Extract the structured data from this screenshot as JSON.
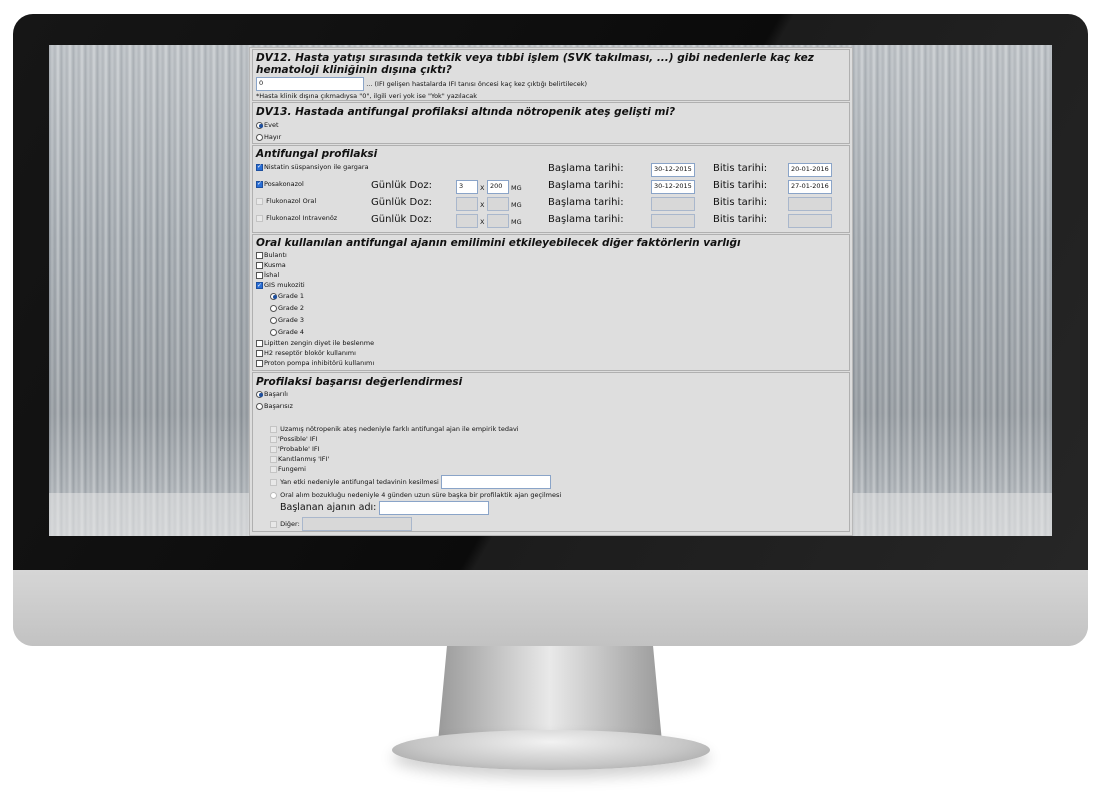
{
  "dv12": {
    "question": "DV12. Hasta yatışı sırasında tetkik veya tıbbi işlem (SVK takılması, ...) gibi nedenlerle kaç kez hematoloji kliniğinin dışına çıktı?",
    "value": "0",
    "hint": "... (IFI gelişen hastalarda IFI tanısı öncesi kaç kez çıktığı belirtilecek)",
    "note": "*Hasta klinik dışına çıkmadıysa \"0\", ilgili veri yok ise \"Yok\" yazılacak"
  },
  "dv13": {
    "question": "DV13. Hastada antifungal profilaksi altında nötropenik ateş gelişti mi?",
    "options": [
      {
        "label": "Evet",
        "selected": true
      },
      {
        "label": "Hayır",
        "selected": false
      }
    ]
  },
  "antifungal": {
    "title": "Antifungal profilaksi",
    "dose_label": "Günlük Doz:",
    "x_label": "X",
    "mg_label": "MG",
    "start_label": "Başlama tarihi:",
    "end_label": "Bitis tarihi:",
    "rows": [
      {
        "name": "Nistatin süspansiyon ile gargara",
        "checked": true,
        "has_dose": false,
        "dose1": "",
        "dose2": "",
        "start": "30-12-2015",
        "end": "20-01-2016"
      },
      {
        "name": "Posakonazol",
        "checked": true,
        "has_dose": true,
        "dose1": "3",
        "dose2": "200",
        "start": "30-12-2015",
        "end": "27-01-2016"
      },
      {
        "name": "Flukonazol Oral",
        "checked": false,
        "has_dose": true,
        "dose1": "",
        "dose2": "",
        "start": "",
        "end": ""
      },
      {
        "name": "Flukonazol Intravenöz",
        "checked": false,
        "has_dose": true,
        "dose1": "",
        "dose2": "",
        "start": "",
        "end": ""
      }
    ]
  },
  "oral": {
    "title": "Oral kullanılan antifungal ajanın emilimini etkileyebilecek diğer faktörlerin varlığı",
    "items": [
      {
        "label": "Bulantı",
        "checked": false
      },
      {
        "label": "Kusma",
        "checked": false
      },
      {
        "label": "İshal",
        "checked": false
      },
      {
        "label": "GIS mukoziti",
        "checked": true
      }
    ],
    "grades": [
      {
        "label": "Grade 1",
        "selected": true
      },
      {
        "label": "Grade 2",
        "selected": false
      },
      {
        "label": "Grade 3",
        "selected": false
      },
      {
        "label": "Grade 4",
        "selected": false
      }
    ],
    "items2": [
      {
        "label": "Lipitten zengin diyet ile beslenme",
        "checked": false
      },
      {
        "label": "H2 reseptör blokör kullanımı",
        "checked": false
      },
      {
        "label": "Proton pompa inhibitörü kullanımı",
        "checked": false
      }
    ]
  },
  "success": {
    "title": "Profilaksi başarısı değerlendirmesi",
    "options": [
      {
        "label": "Başarılı",
        "selected": true
      },
      {
        "label": "Başarısız",
        "selected": false
      }
    ],
    "reasons": [
      "Uzamış nötropenik ateş nedeniyle farklı antifungal ajan ile empirik tedavi",
      "'Possible' IFI",
      "'Probable' IFI",
      "Kanıtlanmış 'IFI'",
      "Fungemi"
    ],
    "side_effect_label": "Yan etki nedeniyle antifungal tedavinin kesilmesi",
    "oral_issue_label": "Oral alım bozukluğu nedeniyle 4 günden uzun süre başka bir profilaktik ajan geçilmesi",
    "agent_label": "Başlanan ajanın adı:",
    "other_label": "Diğer:"
  }
}
